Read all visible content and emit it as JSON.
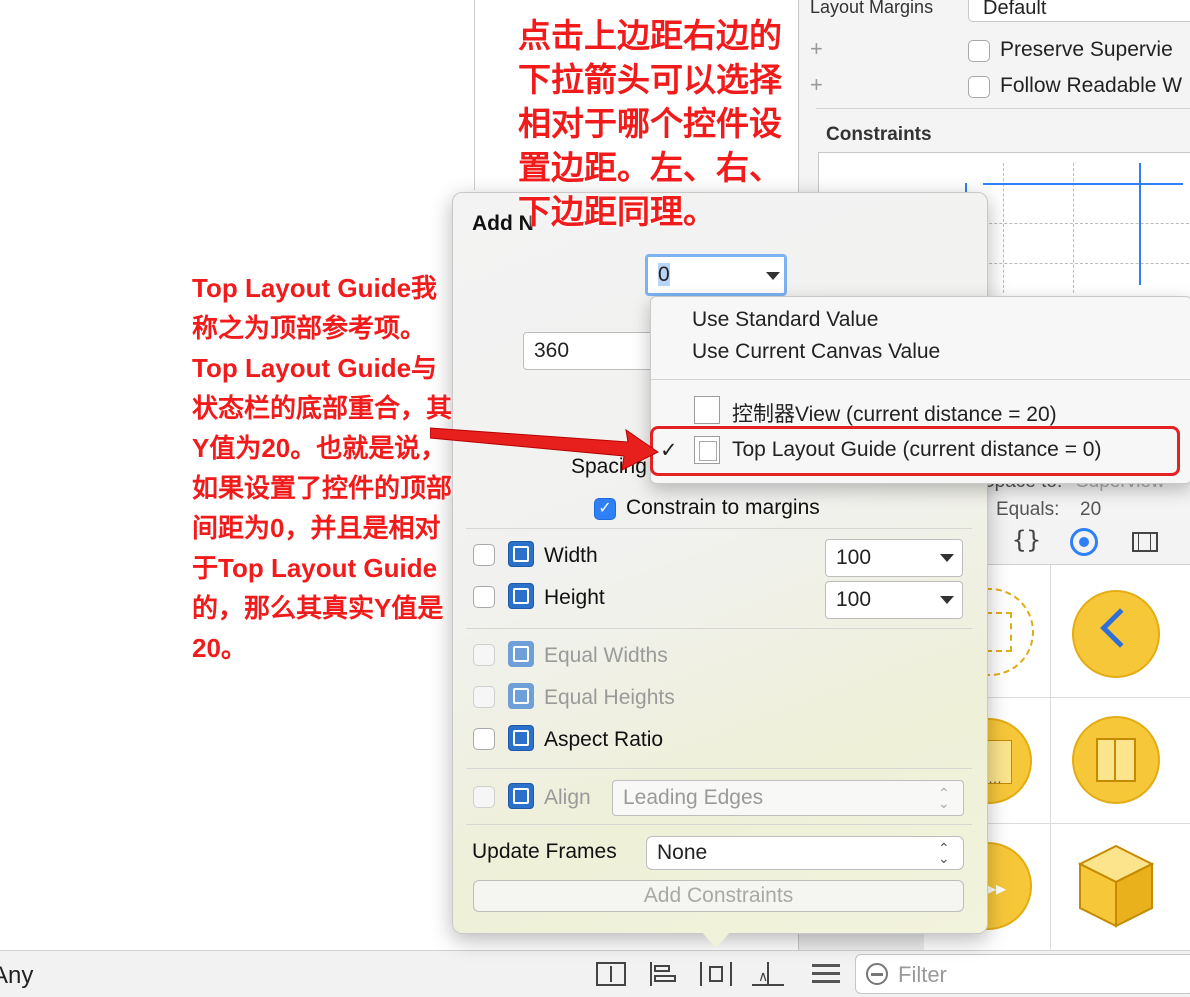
{
  "inspector": {
    "layout_margins_label": "Layout Margins",
    "layout_margins_value": "Default",
    "preserve_superview": "Preserve Supervie",
    "follow_readable": "Follow Readable W",
    "constraints_header": "Constraints",
    "space_to_label": "Space to:",
    "space_to_value": "Superview",
    "equals_label": "Equals:",
    "equals_value": "20"
  },
  "popover": {
    "title": "Add N",
    "top_value": "0",
    "left_value": "360",
    "spacing_label": "Spacing",
    "constrain_to_margins": "Constrain to margins",
    "width_label": "Width",
    "width_value": "100",
    "height_label": "Height",
    "height_value": "100",
    "equal_widths": "Equal Widths",
    "equal_heights": "Equal Heights",
    "aspect_ratio": "Aspect Ratio",
    "align_label": "Align",
    "align_value": "Leading Edges",
    "update_frames_label": "Update Frames",
    "update_frames_value": "None",
    "add_constraints": "Add Constraints"
  },
  "menu": {
    "use_standard": "Use Standard Value",
    "use_canvas": "Use Current Canvas Value",
    "controller_view": "控制器View (current distance = 20)",
    "top_layout_guide": "Top Layout Guide (current distance = 0)",
    "checkmark": "✓"
  },
  "library": {
    "tab_code_icon": "{}",
    "filter_placeholder": "Filter"
  },
  "bottom_bar": {
    "any_label": "Any"
  },
  "annotations": {
    "top_note": "点击上边距右边的\n下拉箭头可以选择\n相对于哪个控件设\n置边距。左、右、\n下边距同理。",
    "left_note": "Top Layout Guide我\n称之为顶部参考项。\nTop Layout Guide与\n状态栏的底部重合，其\nY值为20。也就是说，\n如果设置了控件的顶部\n间距为0，并且是相对\n于Top Layout Guide\n的，那么其真实Y值是\n20。"
  },
  "colors": {
    "annotation_red": "#f21b1b",
    "accent_blue": "#2f7ff6",
    "library_yellow": "#f7c73a"
  }
}
